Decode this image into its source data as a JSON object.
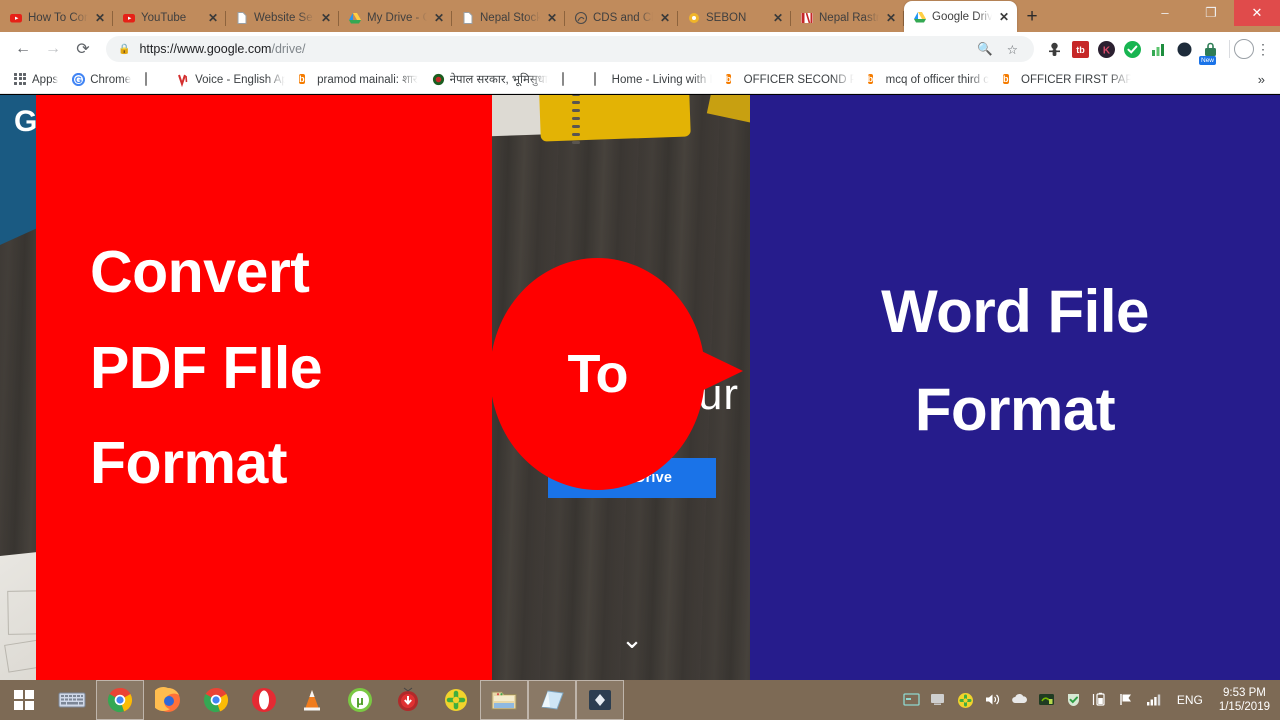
{
  "browser": {
    "tabs": [
      {
        "title": "How To Con",
        "favicon": "youtube-icon",
        "active": false
      },
      {
        "title": "YouTube",
        "favicon": "youtube-icon",
        "active": false
      },
      {
        "title": "Website Se",
        "favicon": "page-icon",
        "active": false
      },
      {
        "title": "My Drive - G",
        "favicon": "google-drive-icon",
        "active": false
      },
      {
        "title": "Nepal Stock",
        "favicon": "page-icon",
        "active": false
      },
      {
        "title": "CDS and Cle",
        "favicon": "cds-icon",
        "active": false
      },
      {
        "title": "SEBON",
        "favicon": "sebon-icon",
        "active": false
      },
      {
        "title": "Nepal Rastr",
        "favicon": "nrb-icon",
        "active": false
      },
      {
        "title": "Google Driv",
        "favicon": "google-drive-icon",
        "active": true
      }
    ],
    "new_tab_label": "+",
    "window_controls": {
      "minimize": "–",
      "maximize": "❐",
      "close": "✕"
    },
    "nav": {
      "back": "←",
      "forward": "→",
      "reload": "⟳"
    },
    "omnibox": {
      "lock_icon": "lock-icon",
      "url_main": "https://www.google.com",
      "url_tail": "/drive/",
      "zoom_icon": "search-zoom-icon",
      "bookmark_icon": "star-icon"
    },
    "extensions": [
      "extension-astronaut-icon",
      "extension-tb-icon",
      "extension-dark-icon",
      "extension-check-icon",
      "extension-chart-icon",
      "extension-grammarly-icon",
      "extension-lock-new-icon"
    ],
    "profile_icon": "profile-avatar-icon",
    "menu_icon": "kebab-menu-icon",
    "bookmarks": [
      {
        "label": "Apps",
        "icon": "apps-grid-icon"
      },
      {
        "label": "Chrome",
        "icon": "chrome-icon"
      },
      {
        "label": "",
        "icon": "page-icon"
      },
      {
        "label": "Voice - English Aptitu",
        "icon": "voice-icon"
      },
      {
        "label": "pramod mainali: शार",
        "icon": "blogger-icon"
      },
      {
        "label": "नेपाल सरकार, भूमिसुधा",
        "icon": "nepal-gov-icon"
      },
      {
        "label": "",
        "icon": "page-icon"
      },
      {
        "label": "Home - Living with IC",
        "icon": "page-icon"
      },
      {
        "label": "OFFICER SECOND PA",
        "icon": "blogger-icon"
      },
      {
        "label": "mcq of officer third c",
        "icon": "blogger-icon"
      },
      {
        "label": "OFFICER FIRST PAPER",
        "icon": "blogger-icon"
      }
    ],
    "bookmarks_overflow": "»"
  },
  "page": {
    "logo_letter": "G",
    "hero_text": "in your",
    "cta_label": "Go to Drive",
    "scroll_chevron": "⌄"
  },
  "overlay": {
    "left_panel": {
      "color": "#ff0000",
      "lines": [
        "Convert",
        "PDF FIle",
        "Format"
      ]
    },
    "badge": {
      "label": "To",
      "color": "#ff0000"
    },
    "right_panel": {
      "color": "#261c8c",
      "lines": [
        "Word File",
        "Format"
      ]
    }
  },
  "taskbar": {
    "start_icon": "windows-start-icon",
    "items": [
      {
        "icon": "keyboard-icon",
        "boxed": false
      },
      {
        "icon": "chrome-icon",
        "boxed": true
      },
      {
        "icon": "firefox-icon",
        "boxed": false
      },
      {
        "icon": "chrome-canary-icon",
        "boxed": false
      },
      {
        "icon": "opera-icon",
        "boxed": false
      },
      {
        "icon": "vlc-icon",
        "boxed": false
      },
      {
        "icon": "utorrent-icon",
        "boxed": false
      },
      {
        "icon": "idm-icon",
        "boxed": false
      },
      {
        "icon": "smadav-icon",
        "boxed": false
      },
      {
        "icon": "file-explorer-icon",
        "boxed": true
      },
      {
        "icon": "sticky-notes-icon",
        "boxed": true
      },
      {
        "icon": "wondershare-icon",
        "boxed": true
      }
    ],
    "tray": [
      "show-hidden-icons-icon",
      "monitor-icon",
      "smadav-tray-icon",
      "volume-icon",
      "onedrive-icon",
      "nvidia-icon",
      "antivirus-shield-icon",
      "battery-icon",
      "flag-action-center-icon",
      "network-signal-icon"
    ],
    "language": "ENG",
    "time": "9:53 PM",
    "date": "1/15/2019"
  }
}
